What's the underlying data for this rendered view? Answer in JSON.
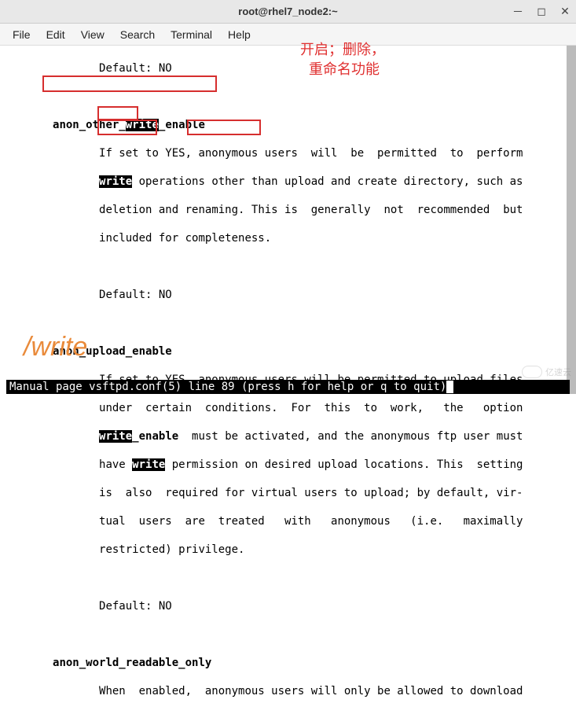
{
  "window": {
    "title": "root@rhel7_node2:~"
  },
  "menu": {
    "items": [
      "File",
      "Edit",
      "View",
      "Search",
      "Terminal",
      "Help"
    ]
  },
  "annotations": {
    "cn_line1": "开启；删除，",
    "cn_line2": "重命名功能",
    "search": "/write"
  },
  "content": {
    "default_label": "Default: NO",
    "opt1_name_a": "anon_other_",
    "opt1_name_b": "write",
    "opt1_name_c": "_enable",
    "opt1_l1_a": "If set to YES, anonymous users  will  be  permitted  to  perform",
    "opt1_l2_b": "write",
    "opt1_l2_c": " operations other than upload and create directory, such as",
    "opt1_l3_a": "deletion",
    "opt1_l3_b": " and ",
    "opt1_l3_c": "renaming.",
    "opt1_l3_d": " This is  generally  not  recommended  but",
    "opt1_l4": "included for completeness.",
    "opt2_name": "anon_upload_enable",
    "opt2_l1": "If set to YES, anonymous users will be permitted to upload files",
    "opt2_l2": "under  certain  conditions.  For  this  to  work,   the   option",
    "opt2_l3_a": "write",
    "opt2_l3_b": "_enable",
    "opt2_l3_c": "  must be activated, and the anonymous ftp user must",
    "opt2_l4_a": "have ",
    "opt2_l4_b": "write",
    "opt2_l4_c": " permission on desired upload locations. This  setting",
    "opt2_l5": "is  also  required for virtual users to upload; by default, vir-",
    "opt2_l6": "tual  users  are  treated   with   anonymous   (i.e.   maximally",
    "opt2_l7": "restricted) privilege.",
    "opt3_name": "anon_world_readable_only",
    "opt3_l1": "When  enabled,  anonymous users will only be allowed to download"
  },
  "status": "Manual page vsftpd.conf(5) line 89 (press h for help or q to quit)",
  "watermark": "亿速云"
}
